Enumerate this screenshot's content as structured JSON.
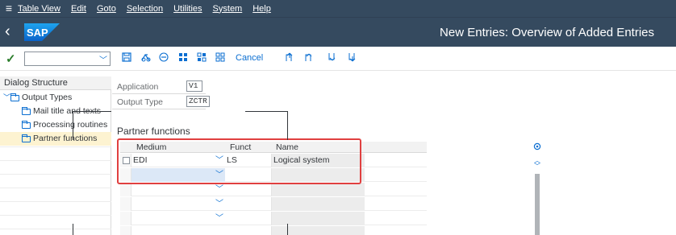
{
  "menubar": {
    "items": [
      "Table View",
      "Edit",
      "Goto",
      "Selection",
      "Utilities",
      "System",
      "Help"
    ]
  },
  "header": {
    "logo_text": "SAP",
    "title": "New Entries: Overview of Added Entries"
  },
  "toolbar": {
    "command_value": "",
    "cancel_label": "Cancel"
  },
  "dialog_structure": {
    "title": "Dialog Structure",
    "items": [
      {
        "label": "Output Types",
        "level": 0,
        "expanded": true,
        "selected": false
      },
      {
        "label": "Mail title and texts",
        "level": 1,
        "selected": false
      },
      {
        "label": "Processing routines",
        "level": 1,
        "selected": false
      },
      {
        "label": "Partner functions",
        "level": 1,
        "selected": true
      }
    ]
  },
  "fields": {
    "application": {
      "label": "Application",
      "value": "V1"
    },
    "output_type": {
      "label": "Output Type",
      "value": "ZCTR"
    }
  },
  "partner_functions": {
    "title": "Partner functions",
    "columns": [
      "Medium",
      "Funct",
      "Name"
    ],
    "rows": [
      {
        "medium": "EDI",
        "funct": "LS",
        "name": "Logical system"
      },
      {
        "medium": "",
        "funct": "",
        "name": ""
      },
      {
        "medium": "",
        "funct": "",
        "name": ""
      },
      {
        "medium": "",
        "funct": "",
        "name": ""
      },
      {
        "medium": "",
        "funct": "",
        "name": ""
      },
      {
        "medium": "",
        "funct": "",
        "name": ""
      }
    ]
  },
  "colors": {
    "shell": "#354a5f",
    "accent": "#0a6ed1",
    "highlight_box": "#e04040",
    "selected_tree_row": "#fdf3d1"
  },
  "icons": [
    "menu-icon",
    "back-icon",
    "checkmark-icon",
    "save-icon",
    "glasses-icon",
    "minus-circle-icon",
    "select-all-icon",
    "deselect-icon",
    "block-select-icon",
    "first-page-icon",
    "previous-page-icon",
    "next-page-icon",
    "last-page-icon",
    "settings-icon"
  ]
}
